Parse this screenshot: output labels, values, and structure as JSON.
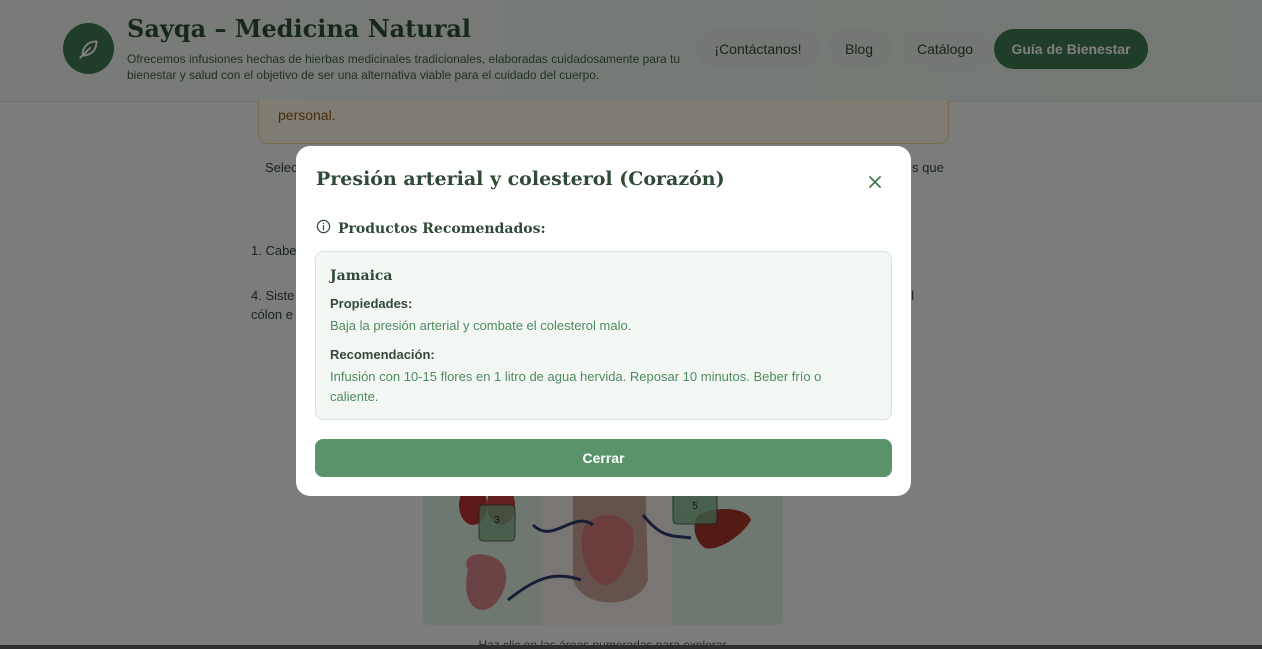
{
  "header": {
    "title": "Sayqa – Medicina Natural",
    "description": "Ofrecemos infusiones hechas de hierbas medicinales tradicionales, elaboradas cuidadosamente para tu bienestar y salud con el objetivo de ser una alternativa viable para el cuidado del cuerpo.",
    "logo_icon": "leaf-icon",
    "nav": [
      {
        "label": "¡Contáctanos!"
      },
      {
        "label": "Blog"
      },
      {
        "label": "Catálogo"
      },
      {
        "label": "Guía de Bienestar",
        "primary": true
      }
    ]
  },
  "background": {
    "notice_text": "personal.",
    "intro_left": "Selec",
    "intro_right": "s que",
    "item_1": "1. Cabe",
    "item_4_left": "4. Siste",
    "item_4_line2": "cólon e",
    "item_4_right": "ol",
    "diagram_markers": [
      "3",
      "5"
    ],
    "caption": "Haz clic en las áreas numeradas para explorar"
  },
  "modal": {
    "title": "Presión arterial y colesterol (Corazón)",
    "close_icon": "close-icon",
    "section_icon": "info-icon",
    "section_label": "Productos Recomendados:",
    "product": {
      "name": "Jamaica",
      "properties_label": "Propiedades:",
      "properties": "Baja la presión arterial y combate el colesterol malo.",
      "recommendation_label": "Recomendación:",
      "recommendation": "Infusión con 10-15 flores en 1 litro de agua hervida. Reposar 10 minutos. Beber frío o caliente."
    },
    "close_button": "Cerrar"
  },
  "colors": {
    "brand": "#3f7a52",
    "button": "#5a936a",
    "accent_text": "#4f8a5f"
  }
}
